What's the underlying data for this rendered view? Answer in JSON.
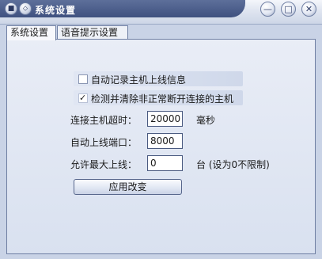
{
  "window": {
    "title": "系统设置"
  },
  "titlebar": {
    "system_icon": "app-menu-icon",
    "rollup_icon": "rollup-icon",
    "minimize_icon": "minimize-icon",
    "maximize_icon": "maximize-icon",
    "close_icon": "close-icon"
  },
  "tabs": [
    {
      "label": "系统设置",
      "active": true
    },
    {
      "label": "语音提示设置",
      "active": false
    }
  ],
  "settings": {
    "auto_log": {
      "label": "自动记录主机上线信息",
      "checked": false
    },
    "detect_clear": {
      "label": "检测并清除非正常断开连接的主机",
      "checked": true
    },
    "timeout": {
      "label": "连接主机超时：",
      "value": "20000",
      "unit": "毫秒"
    },
    "port": {
      "label": "自动上线端口：",
      "value": "8000"
    },
    "max_online": {
      "label": "允许最大上线：",
      "value": "0",
      "unit": "台 (设为0不限制)"
    },
    "apply_label": "应用改变"
  },
  "colors": {
    "title_bar": "#4a5c8a",
    "panel": "#e4e9f4",
    "accent_border": "#6f7fa3"
  }
}
